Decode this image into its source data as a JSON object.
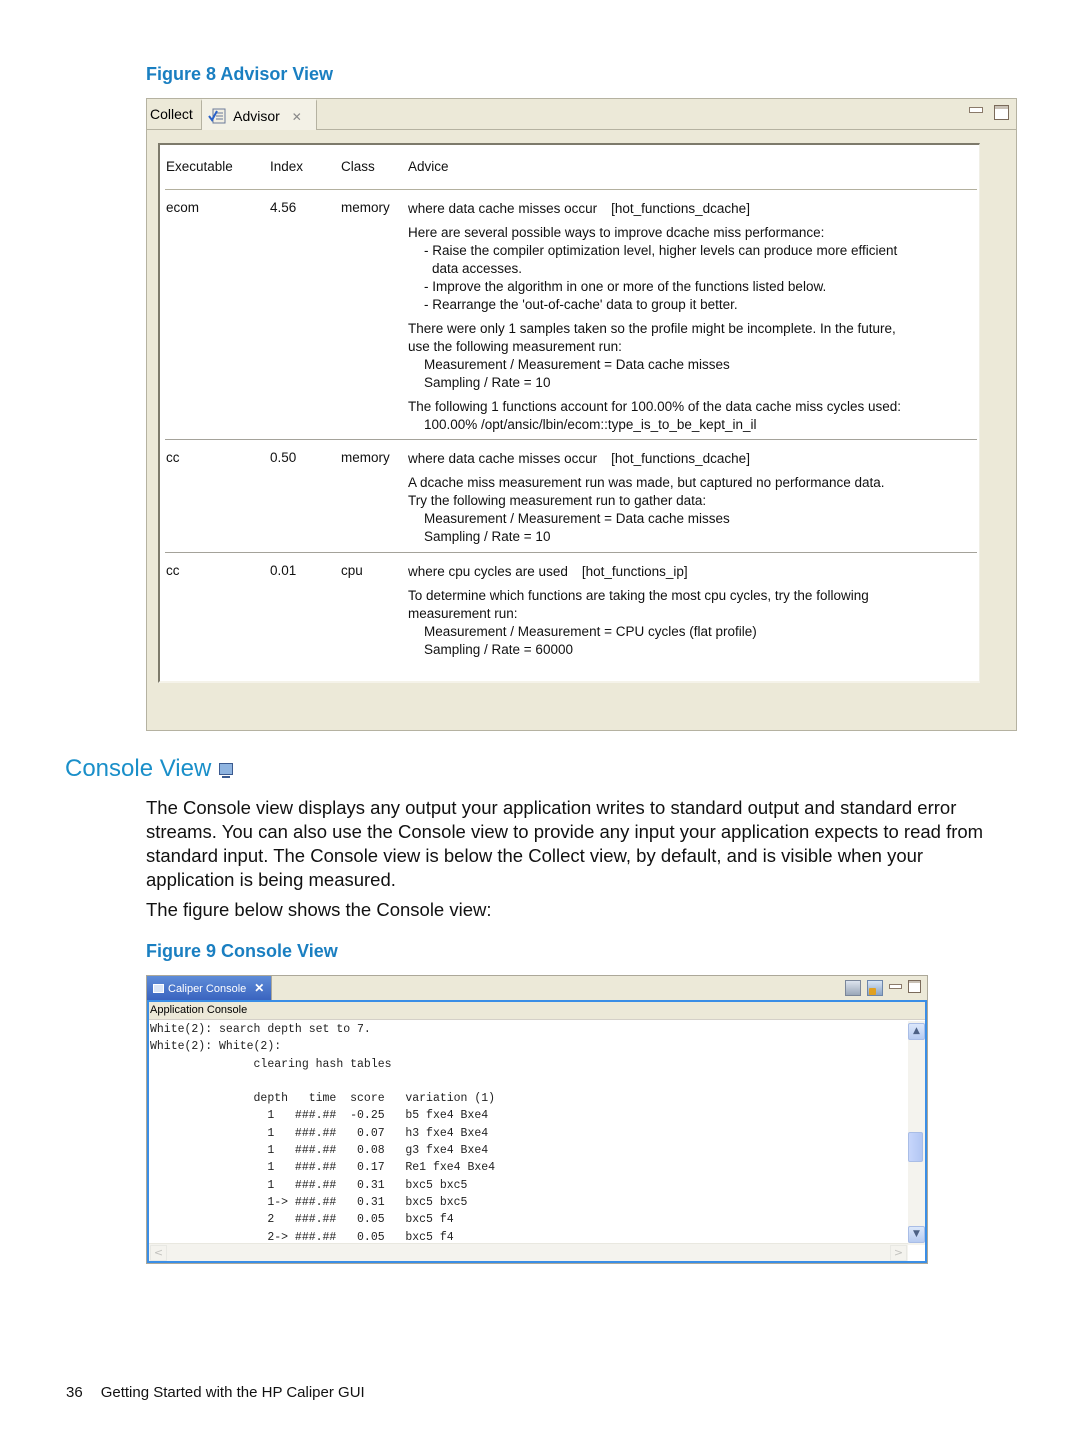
{
  "figure8": {
    "caption": "Figure 8 Advisor View",
    "tabs": [
      {
        "label": "Collect",
        "active": false
      },
      {
        "label": "Advisor",
        "active": true,
        "close": "✕"
      }
    ],
    "columns": [
      "Executable",
      "Index",
      "Class",
      "Advice"
    ],
    "rows": [
      {
        "executable": "ecom",
        "index": "4.56",
        "class": "memory",
        "heading": "where data cache misses occur",
        "tag": "[hot_functions_dcache]",
        "paragraphs": [
          [
            "Here are several possible ways to improve dcache miss performance:",
            "- Raise the compiler optimization level, higher levels can produce more efficient",
            "  data accesses.",
            "- Improve the algorithm in one or more of the functions listed below.",
            "- Rearrange the 'out-of-cache' data to group it better."
          ],
          [
            "There were only 1 samples taken so the profile might be incomplete.  In the future,",
            "use the following measurement run:",
            "Measurement / Measurement = Data cache misses",
            "Sampling / Rate = 10"
          ],
          [
            "The following 1 functions account for 100.00% of the data cache miss cycles used:",
            "100.00%  /opt/ansic/lbin/ecom::type_is_to_be_kept_in_il"
          ]
        ]
      },
      {
        "executable": "cc",
        "index": "0.50",
        "class": "memory",
        "heading": "where data cache misses occur",
        "tag": "[hot_functions_dcache]",
        "paragraphs": [
          [
            "A dcache miss measurement run was made, but captured no performance data.",
            "Try the following measurement run to gather data:",
            "Measurement / Measurement = Data cache misses",
            "Sampling / Rate = 10"
          ]
        ]
      },
      {
        "executable": "cc",
        "index": "0.01",
        "class": "cpu",
        "heading": "where cpu cycles are used",
        "tag": "[hot_functions_ip]",
        "paragraphs": [
          [
            "To determine which functions are taking the most cpu cycles, try the following",
            "measurement run:",
            "Measurement / Measurement = CPU cycles (flat profile)",
            "Sampling / Rate = 60000"
          ]
        ]
      }
    ]
  },
  "section": {
    "title": "Console View",
    "paragraph1": "The Console view displays any output your application writes to standard output and standard error streams. You can also use the Console view to provide any input your application expects to read from standard input. The Console view is below the Collect view, by default, and is visible when your application is being measured.",
    "paragraph2": "The figure below shows the Console view:"
  },
  "figure9": {
    "caption": "Figure 9 Console View",
    "tab_label": "Caliper Console",
    "tab_close": "✕",
    "console_label": "Application Console",
    "lines": [
      "White(2): search depth set to 7.",
      "White(2): White(2):",
      "               clearing hash tables",
      "",
      "               depth   time  score   variation (1)",
      "                 1   ###.##  -0.25   b5 fxe4 Bxe4",
      "                 1   ###.##   0.07   h3 fxe4 Bxe4",
      "                 1   ###.##   0.08   g3 fxe4 Bxe4",
      "                 1   ###.##   0.17   Re1 fxe4 Bxe4",
      "                 1   ###.##   0.31   bxc5 bxc5",
      "                 1-> ###.##   0.31   bxc5 bxc5",
      "                 2   ###.##   0.05   bxc5 f4",
      "                 2-> ###.##   0.05   bxc5 f4"
    ],
    "scroll_up": "▲",
    "scroll_down": "▼",
    "scroll_left": "<",
    "scroll_right": ">"
  },
  "footer": {
    "page_number": "36",
    "title": "Getting Started with the HP Caliper GUI"
  }
}
